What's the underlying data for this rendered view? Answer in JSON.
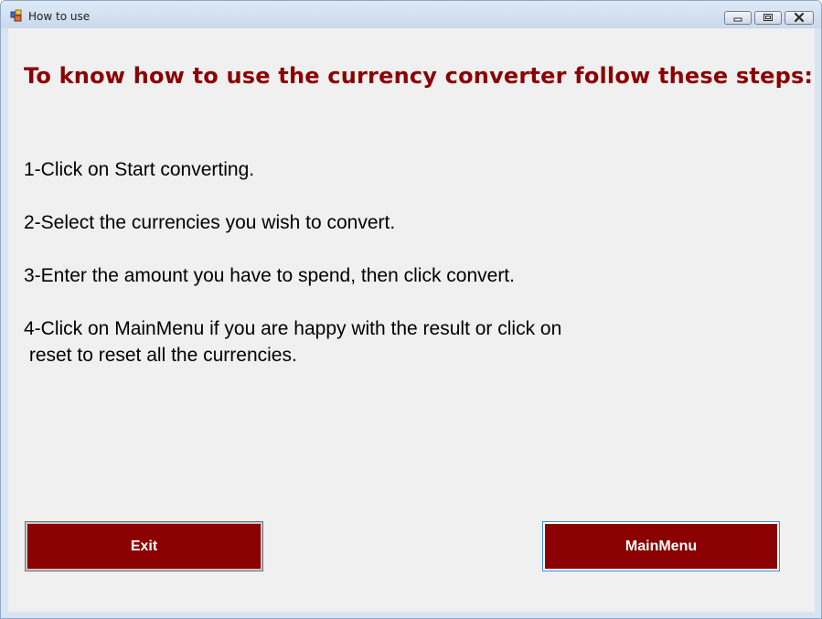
{
  "window": {
    "title": "How to use"
  },
  "content": {
    "heading": "To know how to use the currency converter follow these steps:",
    "steps": [
      "1-Click on Start converting.",
      "2-Select the currencies you wish to convert.",
      "3-Enter the amount you have to spend, then click convert.",
      "4-Click on MainMenu if you are happy with the result or click on\n reset to reset all the currencies."
    ]
  },
  "buttons": {
    "exit_label": "Exit",
    "mainmenu_label": "MainMenu"
  },
  "colors": {
    "accent": "#8b0000",
    "window_bg": "#f0f0f0",
    "button_text": "#ffffff"
  },
  "icons": {
    "app": "app-window-icon",
    "minimize": "minimize-icon",
    "maximize": "maximize-icon",
    "close": "close-icon"
  }
}
